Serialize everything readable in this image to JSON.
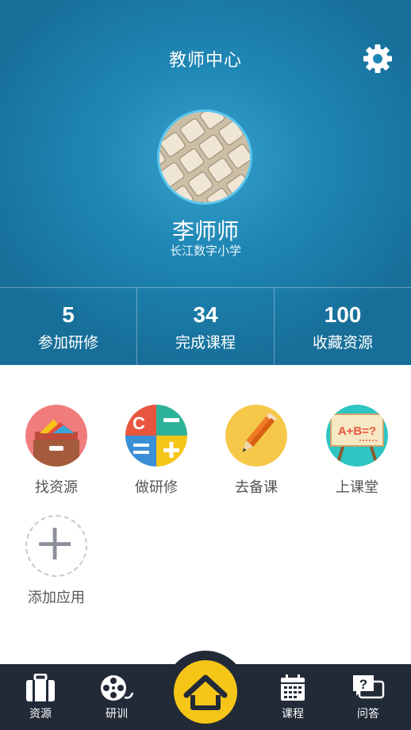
{
  "header": {
    "title": "教师中心",
    "settings_icon": "gear-icon",
    "user": {
      "name": "李师师",
      "school": "长江数字小学"
    }
  },
  "stats": [
    {
      "value": "5",
      "label": "参加研修"
    },
    {
      "value": "34",
      "label": "完成课程"
    },
    {
      "value": "100",
      "label": "收藏资源"
    }
  ],
  "apps": [
    {
      "label": "找资源",
      "icon": "resource-box-icon"
    },
    {
      "label": "做研修",
      "icon": "calculator-icon"
    },
    {
      "label": "去备课",
      "icon": "pencil-icon"
    },
    {
      "label": "上课堂",
      "icon": "blackboard-icon"
    },
    {
      "label": "添加应用",
      "icon": "plus-icon"
    }
  ],
  "tabbar": {
    "items": [
      {
        "label": "资源",
        "icon": "suitcase-icon"
      },
      {
        "label": "研训",
        "icon": "film-reel-icon"
      },
      {
        "label": "",
        "icon": "home-icon"
      },
      {
        "label": "课程",
        "icon": "calendar-icon"
      },
      {
        "label": "问答",
        "icon": "question-chat-icon"
      }
    ]
  },
  "colors": {
    "header_blue": "#1f87b5",
    "tabbar_bg": "#222a37",
    "home_yellow": "#f5c518"
  }
}
